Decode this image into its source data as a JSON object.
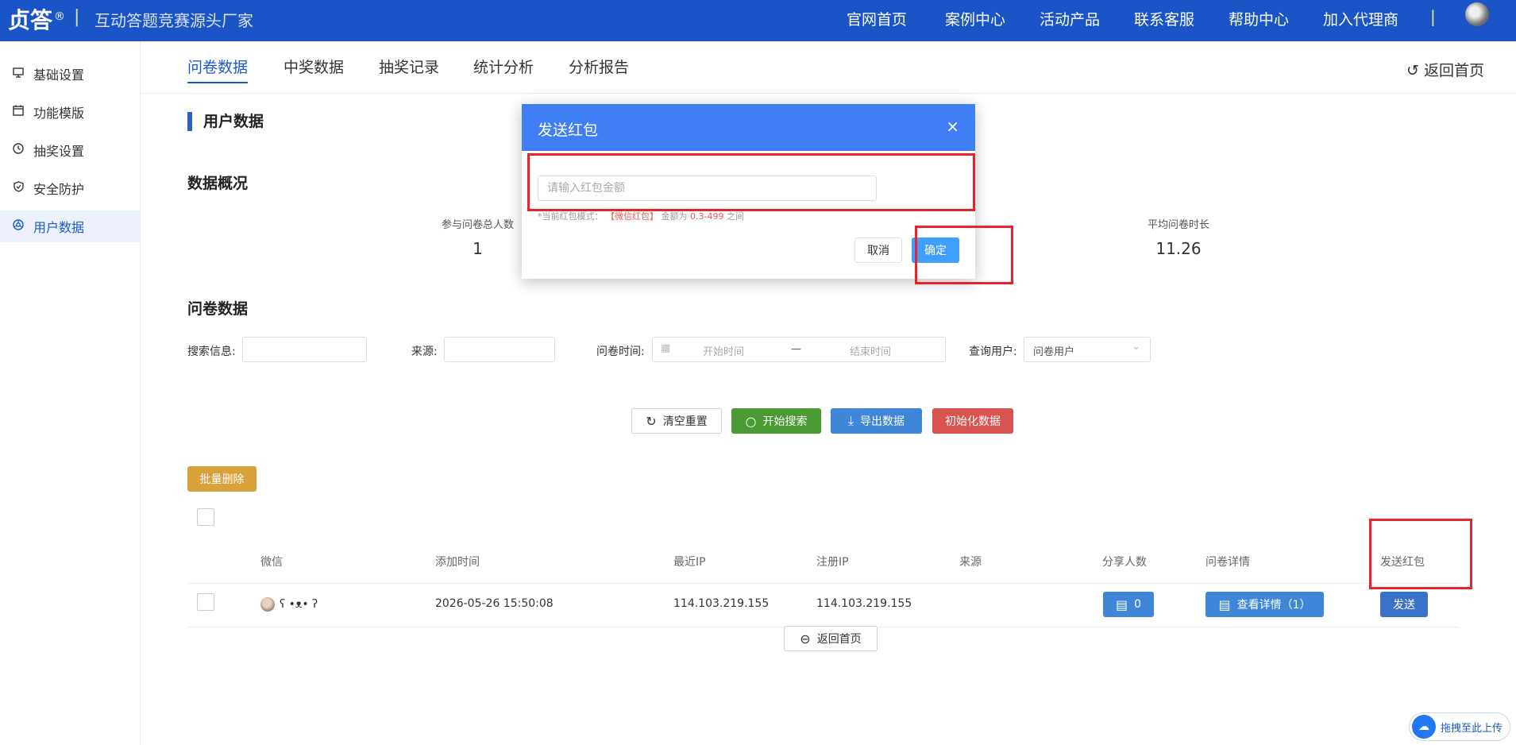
{
  "header": {
    "brand": "贞答",
    "brand_reg": "®",
    "separator": "|",
    "slogan": "互动答题竞赛源头厂家",
    "nav": [
      "官网首页",
      "案例中心",
      "活动产品",
      "联系客服",
      "帮助中心",
      "加入代理商"
    ],
    "nav_separator": "|"
  },
  "sidebar": {
    "items": [
      {
        "label": "基础设置",
        "icon": "monitor-icon"
      },
      {
        "label": "功能模版",
        "icon": "calendar-icon"
      },
      {
        "label": "抽奖设置",
        "icon": "clock-icon"
      },
      {
        "label": "安全防护",
        "icon": "shield-icon"
      },
      {
        "label": "用户数据",
        "icon": "data-icon",
        "active": true
      }
    ]
  },
  "tabs": {
    "items": [
      "问卷数据",
      "中奖数据",
      "抽奖记录",
      "统计分析",
      "分析报告"
    ],
    "active": "问卷数据",
    "back_home": "返回首页"
  },
  "page": {
    "title": "用户数据",
    "overview_title": "数据概况",
    "stats": [
      {
        "label": "参与问卷总人数",
        "value": "1"
      },
      {
        "label": "平均问卷时长",
        "value": "11.26"
      }
    ],
    "survey_title": "问卷数据"
  },
  "filters": {
    "search_label": "搜索信息:",
    "source_label": "来源:",
    "time_label": "问卷时间:",
    "start_placeholder": "开始时间",
    "range_sep": "—",
    "end_placeholder": "结束时间",
    "user_label": "查询用户:",
    "user_select_value": "问卷用户"
  },
  "actions": {
    "reset": "清空重置",
    "search": "开始搜索",
    "export": "导出数据",
    "init": "初始化数据",
    "batch_delete": "批量删除"
  },
  "table": {
    "headers": [
      "微信",
      "添加时间",
      "最近IP",
      "注册IP",
      "来源",
      "分享人数",
      "问卷详情",
      "发送红包"
    ],
    "rows": [
      {
        "wechat": "ʕ •ᴥ• ʔ",
        "added": "2026-05-26 15:50:08",
        "recent_ip": "114.103.219.155",
        "reg_ip": "114.103.219.155",
        "source": "",
        "share_count": "0",
        "detail": "查看详情（1）",
        "send": "发送"
      }
    ]
  },
  "bottom": {
    "back_home": "返回首页"
  },
  "modal": {
    "title": "发送红包",
    "close": "×",
    "input_placeholder": "请输入红包金额",
    "hint_prefix": "*当前红包模式：",
    "hint_mode": "【微信红包】",
    "hint_middle": "金额为",
    "hint_range": "0.3-499",
    "hint_suffix": "之间",
    "cancel": "取消",
    "confirm": "确定"
  },
  "upload": {
    "label": "拖拽至此上传"
  },
  "colors": {
    "header_bg": "#1a54c6",
    "accent": "#1d59c9",
    "modal_header": "#3f7ef5",
    "search_btn": "#4a9b33",
    "export_btn": "#3f86d8",
    "init_btn": "#d9534f",
    "batch_btn": "#d9a13a",
    "highlight": "#e8232c"
  }
}
